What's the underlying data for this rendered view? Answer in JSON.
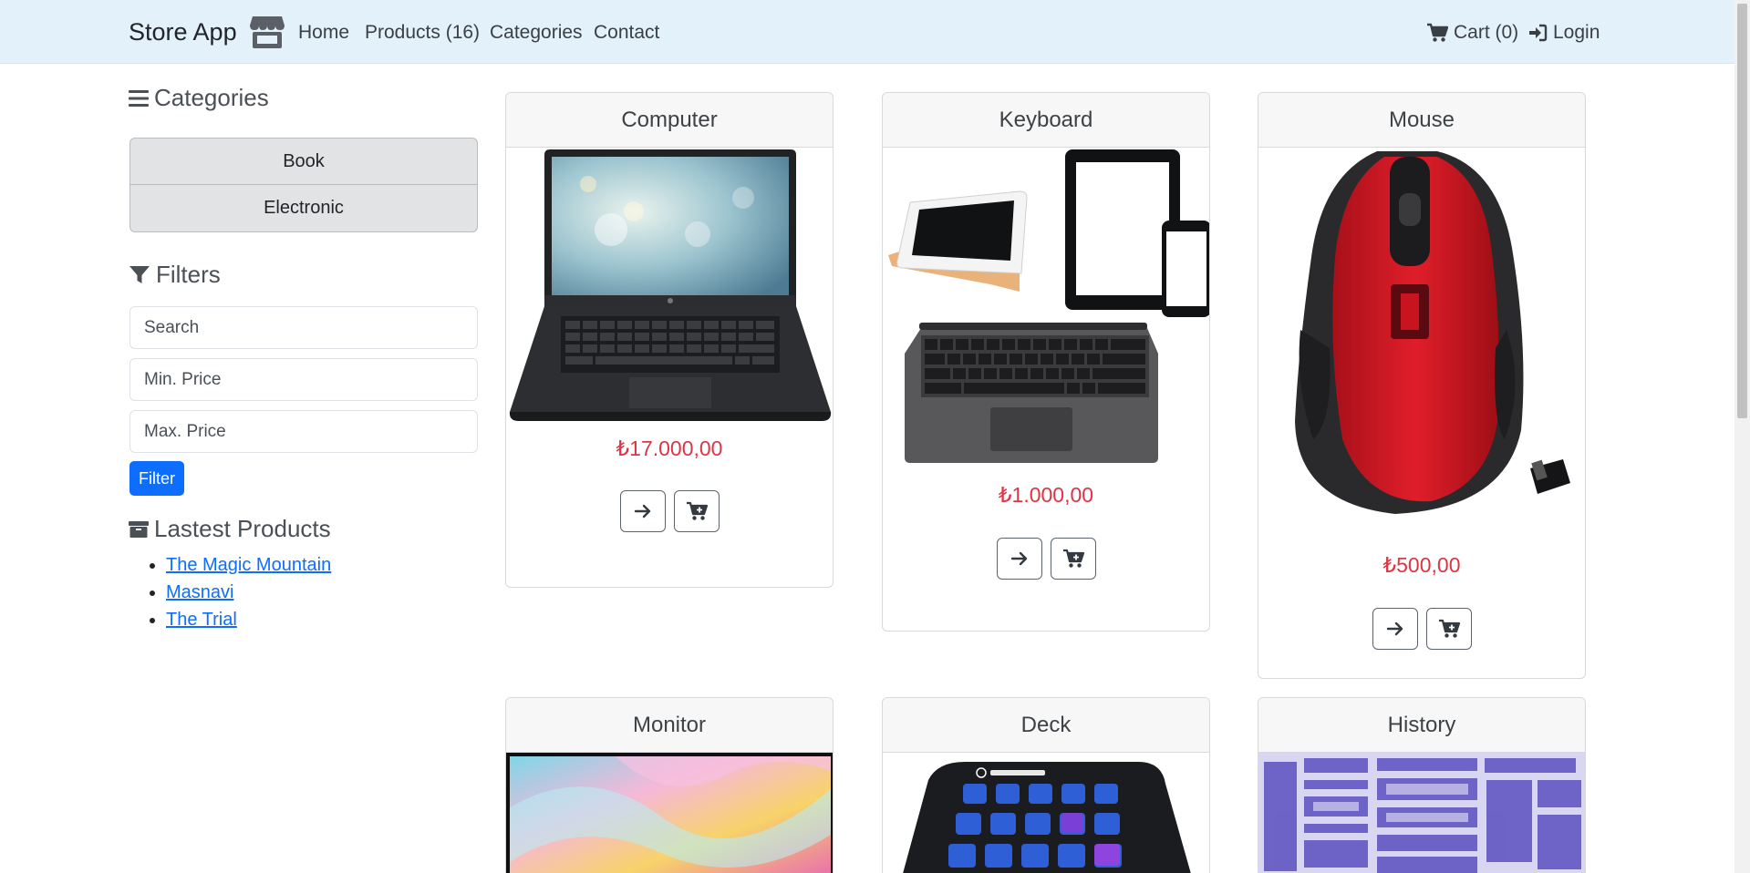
{
  "navbar": {
    "brand": "Store App",
    "links": [
      "Home",
      "Products (16)",
      "Categories",
      "Contact"
    ],
    "cart_label": "Cart (0)",
    "login_label": "Login"
  },
  "sidebar": {
    "categories_heading": "Categories",
    "categories": [
      "Book",
      "Electronic"
    ],
    "filters_heading": "Filters",
    "search_placeholder": "Search",
    "min_price_placeholder": "Min. Price",
    "max_price_placeholder": "Max. Price",
    "filter_button": "Filter",
    "latest_heading": "Lastest Products",
    "latest_products": [
      "The Magic Mountain",
      "Masnavi",
      "The Trial"
    ]
  },
  "products": [
    {
      "name": "Computer",
      "price": "₺17.000,00"
    },
    {
      "name": "Keyboard",
      "price": "₺1.000,00"
    },
    {
      "name": "Mouse",
      "price": "₺500,00"
    },
    {
      "name": "Monitor",
      "price": ""
    },
    {
      "name": "Deck",
      "price": ""
    },
    {
      "name": "History",
      "price": ""
    }
  ],
  "colors": {
    "navbar_bg": "#e3f1fb",
    "primary": "#0d6efd",
    "price": "#dc3545"
  }
}
